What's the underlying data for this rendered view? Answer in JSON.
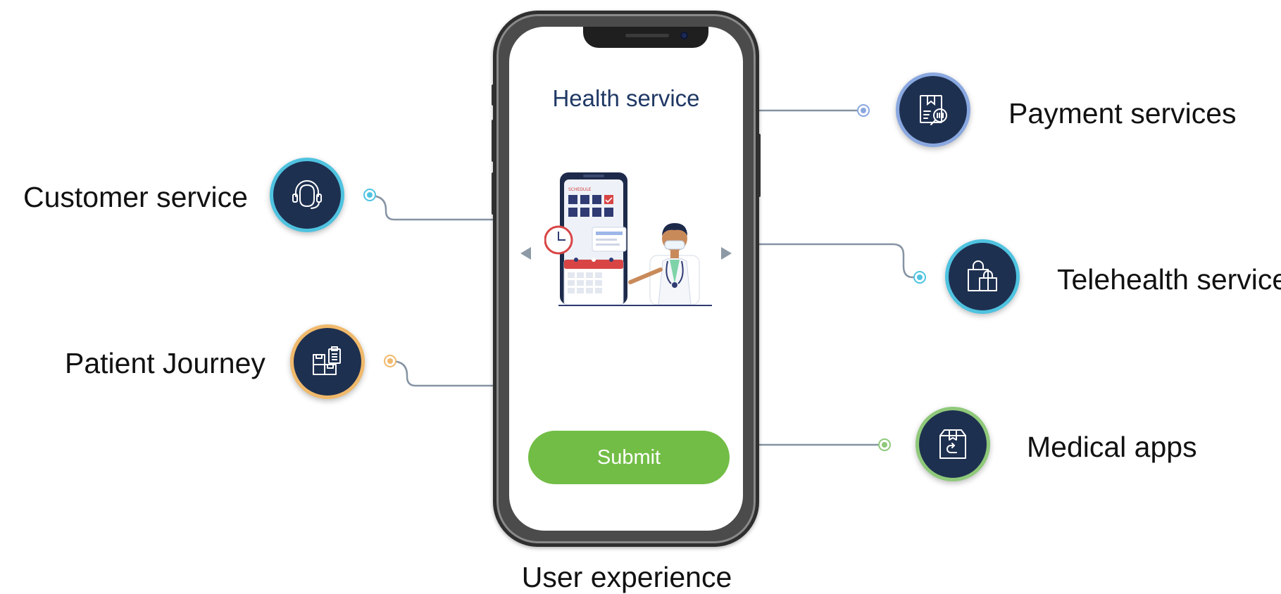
{
  "phone": {
    "screen_title": "Health service",
    "submit_label": "Submit",
    "illustration_header": "SCHEDULE"
  },
  "caption": "User experience",
  "left_items": [
    {
      "label": "Customer service",
      "icon": "headset-icon",
      "color": "#4fc3e0"
    },
    {
      "label": "Patient Journey",
      "icon": "clipboard-boxes-icon",
      "color": "#f0b96b"
    }
  ],
  "right_items": [
    {
      "label": "Payment services",
      "icon": "invoice-search-icon",
      "color": "#8aa8e0"
    },
    {
      "label": "Telehealth service",
      "icon": "shopping-bags-icon",
      "color": "#4fc3e0"
    },
    {
      "label": "Medical apps",
      "icon": "package-return-icon",
      "color": "#8fc97a"
    }
  ],
  "colors": {
    "circle_fill": "#1e3050",
    "connector": "#8090a0",
    "submit": "#72bd46",
    "title": "#1f3864"
  }
}
